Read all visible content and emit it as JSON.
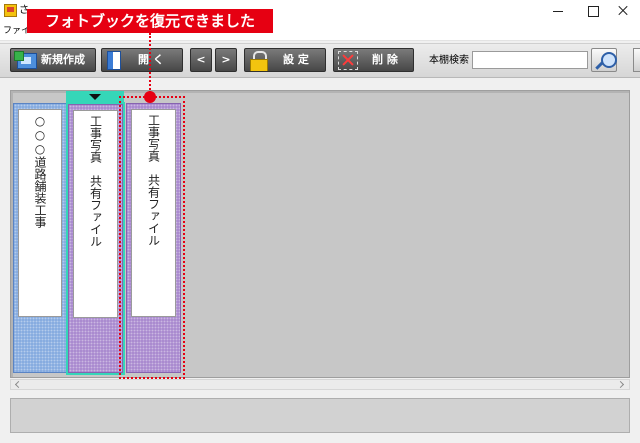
{
  "window": {
    "title": "さ",
    "app_icon": "app-icon",
    "controls": [
      {
        "name": "minimize-icon"
      },
      {
        "name": "maximize-icon"
      },
      {
        "name": "close-icon"
      }
    ]
  },
  "menu": {
    "items": [
      {
        "label": "ファイル"
      }
    ]
  },
  "toolbar": {
    "new_label": "新規作成",
    "new_icon": "new-bookshelf-icon",
    "open_label": "開 く",
    "open_icon": "book-icon",
    "prev_label": "<",
    "next_label": ">",
    "settings_label": "設 定",
    "settings_icon": "lock-icon",
    "delete_label": "削 除",
    "delete_icon": "delete-icon",
    "search_label": "本棚検索",
    "search_value": "",
    "search_icon": "magnifier-icon"
  },
  "shelf": {
    "selection_color": "#35d6b8",
    "binders": [
      {
        "label": "○○○道路舗装工事",
        "color": "#86abe0"
      },
      {
        "label": "工事写真　共有ファイル",
        "color": "#a98acf",
        "selected": true
      },
      {
        "label": "工事写真　共有ファイル",
        "color": "#a98acf"
      }
    ]
  },
  "scrollbar": {
    "left_icon": "scroll-left-icon",
    "right_icon": "scroll-right-icon"
  },
  "callout": {
    "message": "フォトブックを復元できました",
    "color": "#e60012"
  }
}
